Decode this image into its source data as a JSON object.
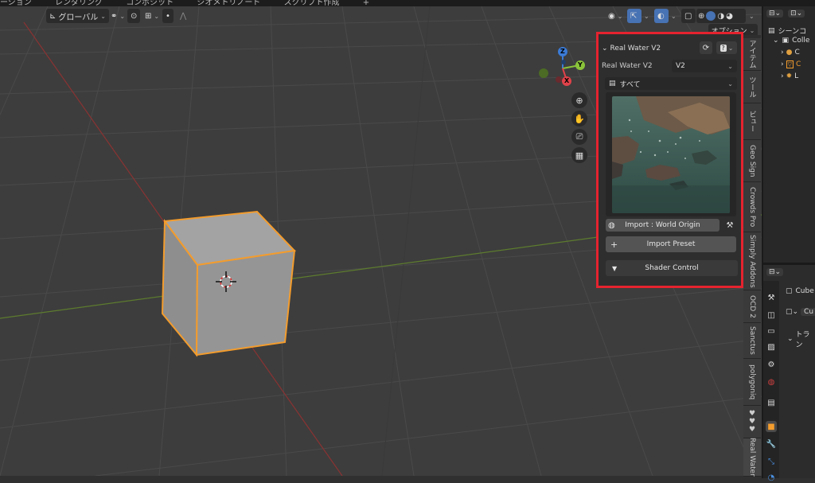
{
  "topbar": {
    "items": [
      "ーション",
      "レンダリング",
      "コンポジット",
      "ジオメトリノード",
      "スクリプト作成",
      "+"
    ]
  },
  "header": {
    "transform_orientation": "グローバル",
    "overlay_label": "オプション"
  },
  "panel": {
    "title": "Real Water V2",
    "version_label": "Real Water V2",
    "version_value": "V2",
    "category_value": "すべて",
    "import_world_origin": "Import : World Origin",
    "import_preset": "Import Preset",
    "shader_control": "Shader Control"
  },
  "tabs": [
    "アイテム",
    "ツール",
    "ビュー",
    "Geo Sign",
    "Crowds Pro",
    "Simply Addons",
    "OCD 2",
    "Sanctus",
    "polygoniq",
    "♥♥♥",
    "Real Water"
  ],
  "outliner": {
    "scene_label": "シーンコ",
    "collection_label": "Colle",
    "items": [
      "C",
      "C",
      "L"
    ]
  },
  "properties": {
    "object_name": "Cube",
    "data_name": "Cu",
    "section_label": "トラン"
  },
  "gizmo": {
    "x": "X",
    "y": "Y",
    "z": "Z"
  },
  "colors": {
    "highlight_border": "#e5232f",
    "selection_outline": "#f39c2d",
    "accent_blue": "#4772b3"
  }
}
